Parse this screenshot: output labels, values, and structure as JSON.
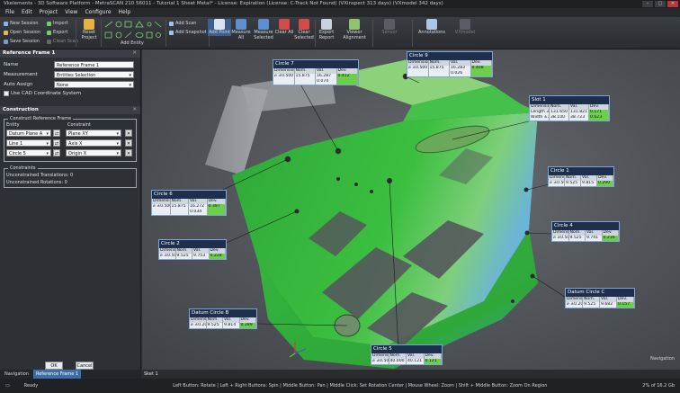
{
  "window": {
    "title": "Vkelements - 3D Software Platform - MetraSCAN 210 56011 - Tutorial 1 Sheet Metal* - License: Expiration (License: C-Track Not Found) (VXinspect 313 days) (VXmodel 342 days)"
  },
  "menu": [
    "File",
    "Edit",
    "Project",
    "View",
    "Configure",
    "Help"
  ],
  "ribbon": {
    "session": [
      "New Session",
      "Open Session",
      "Save Session"
    ],
    "file_ops": [
      "Import",
      "Export",
      "Clean Scan"
    ],
    "reset_project": "Reset Project",
    "add_entity": "Add Entity",
    "scan": [
      "Add Scan",
      "Add Snapshot"
    ],
    "big_buttons": [
      "Add Point",
      "Measure All",
      "Measure Selected",
      "Clear All",
      "Clear Selected",
      "Export Report",
      "Viewer Alignment",
      "Sensor",
      "Annotations",
      "VXmodel"
    ]
  },
  "panel": {
    "title": "Reference Frame 1",
    "name_label": "Name",
    "name_value": "Reference Frame 1",
    "measurement_label": "Measurement",
    "measurement_value": "Entities Selection",
    "auto_assign_label": "Auto Assign",
    "auto_assign_value": "None",
    "use_cad": "Use CAD Coordinate System",
    "construction_header": "Construction",
    "construct_title": "Construct Reference Frame",
    "entity_col": "Entity",
    "constraint_col": "Constraint",
    "rows": [
      {
        "entity": "Datum Plane A",
        "constraint": "Plane XY"
      },
      {
        "entity": "Line 1",
        "constraint": "Axis X"
      },
      {
        "entity": "Circle 5",
        "constraint": "Origin X"
      }
    ],
    "constraints_title": "Constraints",
    "translations": "Unconstrained Translations: 0",
    "rotations": "Unconstrained Rotations: 0",
    "ok": "OK",
    "cancel": "Cancel"
  },
  "bottom_tabs": [
    "Navigation",
    "Reference Frame 1"
  ],
  "viewport_tab": "Sket 1",
  "annotations": [
    {
      "id": "circle7",
      "title": "Circle 7",
      "hdr": [
        "Dimension",
        "Nom.",
        "Val.",
        "Dev."
      ],
      "r1": [
        "⌀ ±0.500",
        "15.875",
        "16.287",
        "0.412"
      ],
      "r2": [
        "",
        "",
        "0.074",
        ""
      ]
    },
    {
      "id": "circle9",
      "title": "Circle 9",
      "hdr": [
        "Dimension",
        "Nom.",
        "Val.",
        "Dev."
      ],
      "r1": [
        "⌀ ±0.500",
        "15.875",
        "16.283",
        "0.408"
      ],
      "r2": [
        "",
        "",
        "0.026",
        ""
      ]
    },
    {
      "id": "slot1",
      "title": "Slot 1",
      "hdr": [
        "Dimension",
        "Nom.",
        "Val.",
        "Dev."
      ],
      "r1": [
        "Length ±1.000",
        "131.650",
        "131.821",
        "0.171"
      ],
      "r2": [
        "Width ±1.000",
        "38.100",
        "38.723",
        "0.623"
      ]
    },
    {
      "id": "circle1",
      "title": "Circle 1",
      "hdr": [
        "Dimension",
        "Nom.",
        "Val.",
        "Dev."
      ],
      "r1": [
        "⌀ ±0.500",
        "9.525",
        "9.815",
        "0.290"
      ],
      "r2": [
        "",
        "",
        "",
        ""
      ]
    },
    {
      "id": "circle6",
      "title": "Circle 6",
      "hdr": [
        "Dimension",
        "Nom.",
        "Val.",
        "Dev."
      ],
      "r1": [
        "⌀ ±0.500",
        "15.875",
        "16.272",
        "0.397"
      ],
      "r2": [
        "",
        "",
        "0.034",
        ""
      ]
    },
    {
      "id": "circle4",
      "title": "Circle 4",
      "hdr": [
        "Dimension",
        "Nom.",
        "Val.",
        "Dev."
      ],
      "r1": [
        "⌀ ±0.500",
        "9.525",
        "9.741",
        "0.216"
      ],
      "r2": [
        "",
        "",
        "",
        ""
      ]
    },
    {
      "id": "circle2",
      "title": "Circle 2",
      "hdr": [
        "Dimension",
        "Nom.",
        "Val.",
        "Dev."
      ],
      "r1": [
        "⌀ ±0.500",
        "9.525",
        "9.753",
        "0.228"
      ],
      "r2": [
        "",
        "",
        "",
        ""
      ]
    },
    {
      "id": "datumc",
      "title": "Datum Circle C",
      "hdr": [
        "Dimension",
        "Nom.",
        "Val.",
        "Dev."
      ],
      "r1": [
        "⌀ ±0.200",
        "9.525",
        "9.682",
        "0.157"
      ],
      "r2": [
        "",
        "",
        "",
        ""
      ]
    },
    {
      "id": "datumb",
      "title": "Datum Circle B",
      "hdr": [
        "Dimension",
        "Nom.",
        "Val.",
        "Dev."
      ],
      "r1": [
        "⌀ ±0.200",
        "9.525",
        "9.814",
        "0.289"
      ],
      "r2": [
        "",
        "",
        "",
        ""
      ]
    },
    {
      "id": "circle5",
      "title": "Circle 5",
      "hdr": [
        "Dimension",
        "Nom.",
        "Val.",
        "Dev."
      ],
      "r1": [
        "⌀ ±0.500",
        "40.000",
        "40.121",
        "0.121"
      ],
      "r2": [
        "",
        "",
        "",
        ""
      ]
    }
  ],
  "navigation_label": "Navigation",
  "status": {
    "ready": "Ready",
    "hints": "Left Button: Rotate | Left + Right Buttons: Spin | Middle Button: Pan | Middle Click: Set Rotation Center | Mouse Wheel: Zoom | Shift + Middle Button: Zoom On Region",
    "memory": "2% of 16.2 Gb"
  }
}
